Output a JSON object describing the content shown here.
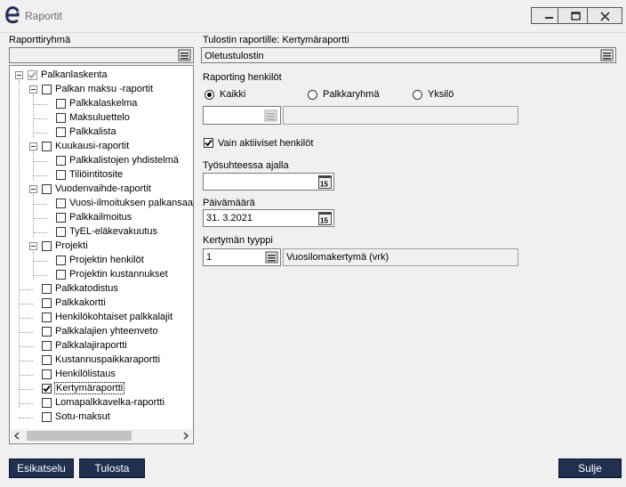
{
  "window": {
    "title": "Raportit"
  },
  "left": {
    "group_label": "Raporttiryhmä",
    "group_value": "",
    "tree": [
      {
        "label": "Palkanlaskenta",
        "checked": "gray"
      },
      {
        "label": "Palkan maksu -raportit",
        "checked": false
      },
      {
        "label": "Palkkalaskelma",
        "checked": false
      },
      {
        "label": "Maksuluettelo",
        "checked": false
      },
      {
        "label": "Palkkalista",
        "checked": false
      },
      {
        "label": "Kuukausi-raportit",
        "checked": false
      },
      {
        "label": "Palkkalistojen yhdistelmä",
        "checked": false
      },
      {
        "label": "Tiliöintitosite",
        "checked": false
      },
      {
        "label": "Vuodenvaihde-raportit",
        "checked": false
      },
      {
        "label": "Vuosi-ilmoituksen palkansaaja",
        "checked": false
      },
      {
        "label": "Palkkailmoitus",
        "checked": false
      },
      {
        "label": "TyEL-eläkevakuutus",
        "checked": false
      },
      {
        "label": "Projekti",
        "checked": false
      },
      {
        "label": "Projektin henkilöt",
        "checked": false
      },
      {
        "label": "Projektin kustannukset",
        "checked": false
      },
      {
        "label": "Palkkatodistus",
        "checked": false
      },
      {
        "label": "Palkkakortti",
        "checked": false
      },
      {
        "label": "Henkilökohtaiset palkkalajit",
        "checked": false
      },
      {
        "label": "Palkkalajien yhteenveto",
        "checked": false
      },
      {
        "label": "Palkkalajiraportti",
        "checked": false
      },
      {
        "label": "Kustannuspaikkaraportti",
        "checked": false
      },
      {
        "label": "Henkilölistaus",
        "checked": false
      },
      {
        "label": "Kertymäraportti",
        "checked": true
      },
      {
        "label": "Lomapalkkavelka-raportti",
        "checked": false
      },
      {
        "label": "Sotu-maksut",
        "checked": false
      }
    ]
  },
  "right": {
    "printer_label": "Tulostin raportille: Kertymäraportti",
    "printer_value": "Oletustulostin",
    "persons_label": "Raporting henkilöt",
    "radio_options": [
      "Kaikki",
      "Palkkaryhmä",
      "Yksilö"
    ],
    "radio_selected": "Kaikki",
    "group_code": "",
    "group_name": "",
    "active_only_label": "Vain aktiiviset henkilöt",
    "active_only": true,
    "employment_label": "Työsuhteessa ajalla",
    "employment_value": "",
    "date_label": "Päivämäärä",
    "date_value": "31. 3.2021",
    "type_label": "Kertymän tyyppi",
    "type_code": "1",
    "type_name": "Vuosilomakertymä (vrk)"
  },
  "buttons": {
    "preview": "Esikatselu",
    "print": "Tulosta",
    "close": "Sulje"
  }
}
